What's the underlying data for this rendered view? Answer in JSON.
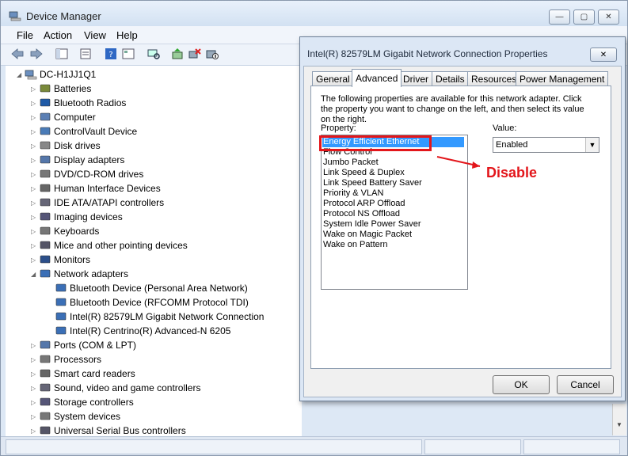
{
  "window": {
    "title": "Device Manager",
    "controls": [
      "—",
      "▢",
      "✕"
    ]
  },
  "menu": [
    "File",
    "Action",
    "View",
    "Help"
  ],
  "tree": {
    "root": "DC-H1JJ1Q1",
    "categories": [
      "Batteries",
      "Bluetooth Radios",
      "Computer",
      "ControlVault Device",
      "Disk drives",
      "Display adapters",
      "DVD/CD-ROM drives",
      "Human Interface Devices",
      "IDE ATA/ATAPI controllers",
      "Imaging devices",
      "Keyboards",
      "Mice and other pointing devices",
      "Monitors",
      "Network adapters"
    ],
    "network_children": [
      "Bluetooth Device (Personal Area Network)",
      "Bluetooth Device (RFCOMM Protocol TDI)",
      "Intel(R) 82579LM Gigabit Network Connection",
      "Intel(R) Centrino(R) Advanced-N 6205"
    ],
    "categories_after": [
      "Ports (COM & LPT)",
      "Processors",
      "Smart card readers",
      "Sound, video and game controllers",
      "Storage controllers",
      "System devices",
      "Universal Serial Bus controllers"
    ]
  },
  "dialog": {
    "title": "Intel(R) 82579LM Gigabit Network Connection Properties",
    "close": "✕",
    "tabs": [
      "General",
      "Advanced",
      "Driver",
      "Details",
      "Resources",
      "Power Management"
    ],
    "active_tab": "Advanced",
    "description": "The following properties are available for this network adapter. Click the property you want to change on the left, and then select its value on the right.",
    "property_label": "Property:",
    "value_label": "Value:",
    "properties": [
      "Energy Efficient Ethernet",
      "Flow Control",
      "Jumbo Packet",
      "Link Speed & Duplex",
      "Link Speed Battery Saver",
      "Priority & VLAN",
      "Protocol ARP Offload",
      "Protocol NS Offload",
      "System Idle Power Saver",
      "Wake on Magic Packet",
      "Wake on Pattern"
    ],
    "selected_property": "Energy Efficient Ethernet",
    "value": "Enabled",
    "ok": "OK",
    "cancel": "Cancel"
  },
  "annotation": {
    "text": "Disable",
    "color": "#e3161b"
  }
}
